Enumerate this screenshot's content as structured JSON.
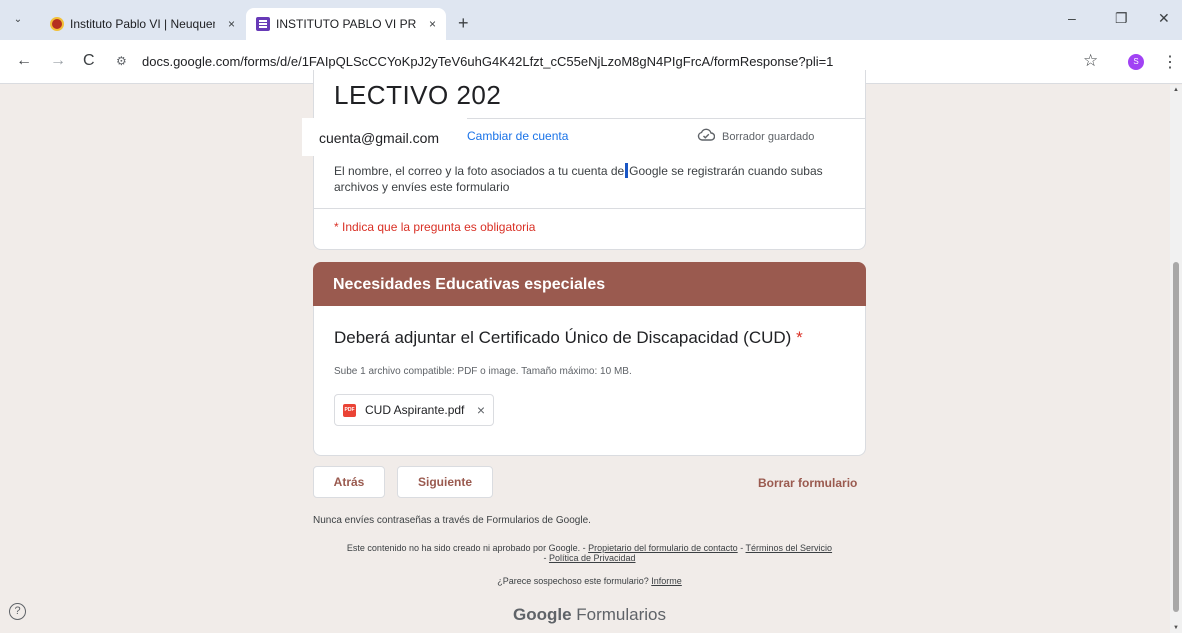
{
  "browser": {
    "tabs": [
      {
        "title": "Instituto Pablo VI | Neuquen",
        "close": "×"
      },
      {
        "title": "INSTITUTO PABLO VI PRE-INSCRIPCI",
        "close": "×"
      }
    ],
    "new_tab": "+",
    "tab_menu": "⌄",
    "window_controls": {
      "minimize": "–",
      "restore": "❐",
      "close": "✕"
    },
    "nav": {
      "back": "←",
      "forward": "→",
      "reload": "C"
    },
    "url": "docs.google.com/forms/d/e/1FAIpQLScCCYoKpJ2yTeV6uhG4K42Lfzt_cC55eNjLzoM8gN4PIgFrcA/formResponse?pli=1",
    "site_info_icon": "tune-icon",
    "bookmark_icon": "☆",
    "profile_initial": "S",
    "menu_icon": "⋮"
  },
  "form": {
    "title": "LECTIVO 202",
    "account_email": "cuenta@gmail.com",
    "switch_account": "Cambiar de cuenta",
    "draft_status": "Borrador guardado",
    "notice_before": "El nombre, el correo y la foto asociados a tu cuenta de",
    "notice_after": "Google se registrarán cuando subas archivos y envíes este formulario",
    "required_note": "* Indica que la pregunta es obligatoria",
    "section_title": "Necesidades Educativas especiales",
    "question": "Deberá adjuntar el  Certificado Único de Discapacidad (CUD)",
    "required_mark": "*",
    "help_text": "Sube 1 archivo compatible: PDF o image. Tamaño máximo: 10 MB.",
    "file_name": "CUD Aspirante.pdf",
    "file_type_badge": "PDF",
    "file_remove": "×",
    "back_button": "Atrás",
    "next_button": "Siguiente",
    "clear_button": "Borrar formulario"
  },
  "footer": {
    "warning": "Nunca envíes contraseñas a través de Formularios de Google.",
    "legal_prefix": "Este contenido no ha sido creado ni aprobado por Google. - ",
    "owner_link": "Propietario del formulario de contacto",
    "separator": " - ",
    "terms_link": "Términos del Servicio",
    "privacy_link": "Política de Privacidad",
    "report_prefix": "¿Parece sospechoso este formulario? ",
    "report_link": "Informe",
    "brand_google": "Google",
    "brand_product": "Formularios",
    "help_icon": "?"
  },
  "colors": {
    "theme": "#9a5a4f",
    "background": "#f1ece9",
    "required": "#d93025",
    "link": "#1a73e8"
  }
}
